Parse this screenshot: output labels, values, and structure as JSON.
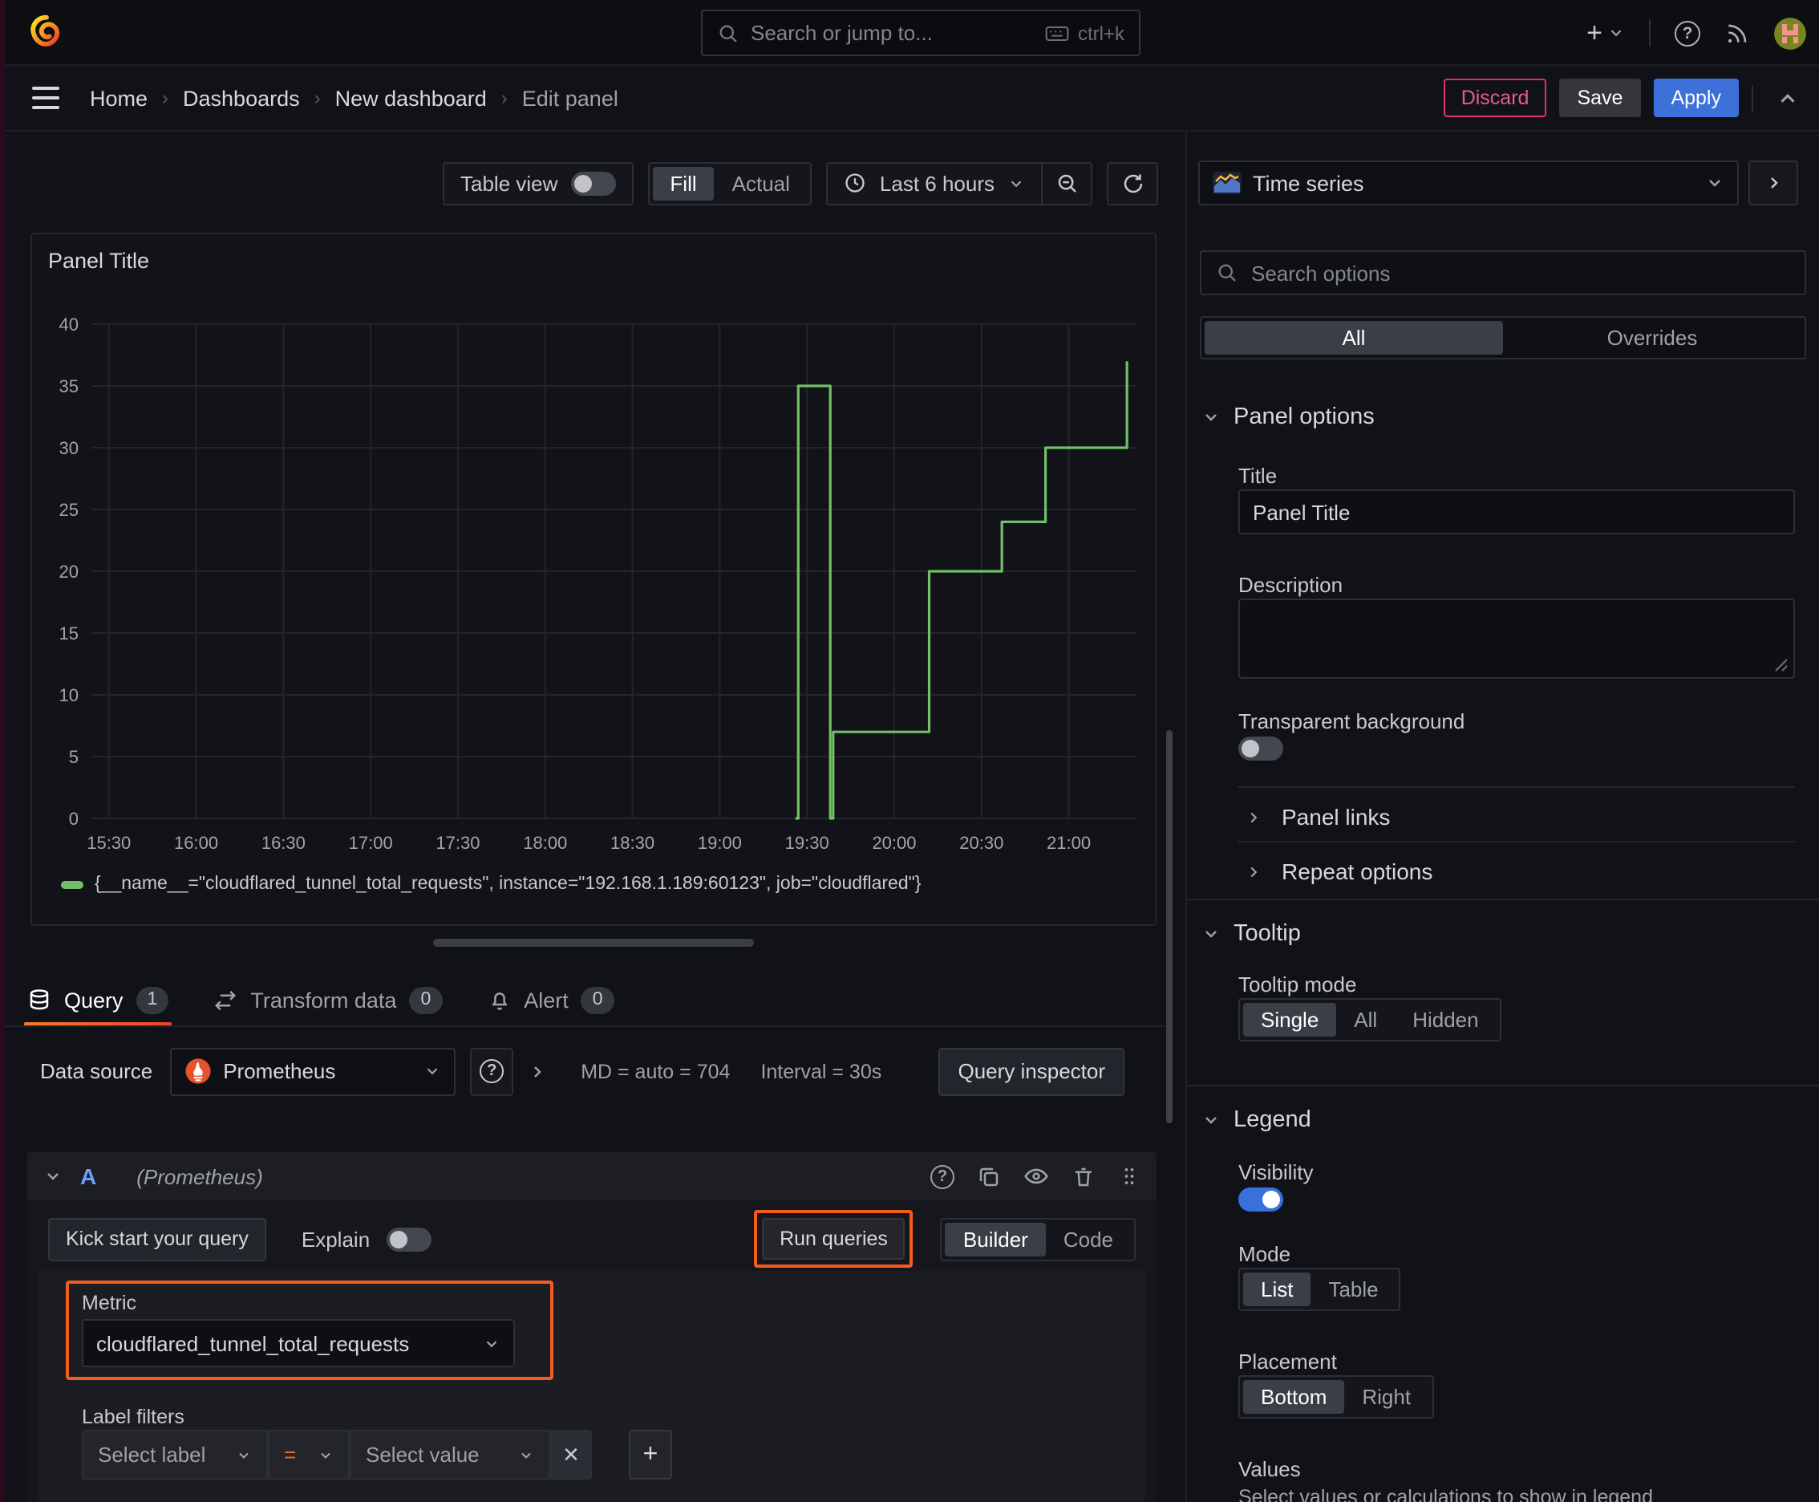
{
  "navbar": {
    "search_placeholder": "Search or jump to...",
    "search_shortcut": "ctrl+k"
  },
  "breadcrumb": {
    "items": [
      "Home",
      "Dashboards",
      "New dashboard",
      "Edit panel"
    ],
    "discard": "Discard",
    "save": "Save",
    "apply": "Apply"
  },
  "toolbar": {
    "table_view": "Table view",
    "fill": "Fill",
    "actual": "Actual",
    "time_range": "Last 6 hours"
  },
  "panel": {
    "title": "Panel Title"
  },
  "chart_data": {
    "type": "line",
    "title": "Panel Title",
    "step": true,
    "grid": true,
    "legend_position": "bottom",
    "x_ticks": [
      "15:30",
      "16:00",
      "16:30",
      "17:00",
      "17:30",
      "18:00",
      "18:30",
      "19:00",
      "19:30",
      "20:00",
      "20:30",
      "21:00"
    ],
    "y_ticks": [
      0,
      5,
      10,
      15,
      20,
      25,
      30,
      35,
      40
    ],
    "x_range": [
      "15:24",
      "21:23"
    ],
    "y_range": [
      0,
      40
    ],
    "series": [
      {
        "name": "{__name__=\"cloudflared_tunnel_total_requests\", instance=\"192.168.1.189:60123\", job=\"cloudflared\"}",
        "color": "#73bf69",
        "points": [
          [
            "19:26",
            0
          ],
          [
            "19:27",
            35
          ],
          [
            "19:38",
            0
          ],
          [
            "19:39",
            7
          ],
          [
            "20:12",
            20
          ],
          [
            "20:37",
            24
          ],
          [
            "20:52",
            30
          ],
          [
            "21:20",
            37
          ]
        ]
      }
    ]
  },
  "tabs": {
    "query": "Query",
    "query_count": "1",
    "transform": "Transform data",
    "transform_count": "0",
    "alert": "Alert",
    "alert_count": "0"
  },
  "datasource": {
    "label": "Data source",
    "name": "Prometheus",
    "md": "MD = auto = 704",
    "interval": "Interval = 30s",
    "inspector": "Query inspector"
  },
  "query_editor": {
    "ref_id": "A",
    "ds_hint": "(Prometheus)",
    "kick_start": "Kick start your query",
    "explain": "Explain",
    "run_queries": "Run queries",
    "builder": "Builder",
    "code": "Code",
    "metric_label": "Metric",
    "metric_value": "cloudflared_tunnel_total_requests",
    "label_filters": "Label filters",
    "select_label": "Select label",
    "equals": "=",
    "select_value": "Select value",
    "remove": "✕",
    "add": "+"
  },
  "options": {
    "panel_type": "Time series",
    "search_placeholder": "Search options",
    "tab_all": "All",
    "tab_overrides": "Overrides",
    "panel_options": "Panel options",
    "title_label": "Title",
    "title_value": "Panel Title",
    "description_label": "Description",
    "transparent_bg": "Transparent background",
    "panel_links": "Panel links",
    "repeat_options": "Repeat options",
    "tooltip": "Tooltip",
    "tooltip_mode": "Tooltip mode",
    "tooltip_modes": [
      "Single",
      "All",
      "Hidden"
    ],
    "legend": "Legend",
    "visibility": "Visibility",
    "mode": "Mode",
    "modes": [
      "List",
      "Table"
    ],
    "placement": "Placement",
    "placements": [
      "Bottom",
      "Right"
    ],
    "values_label": "Values",
    "values_help": "Select values or calculations to show in legend"
  },
  "colors": {
    "accent_orange": "#f25c1f",
    "apply_blue": "#3d71d9",
    "discard_pink": "#e0316e",
    "series_green": "#73bf69",
    "toggle_blue": "#3871dc"
  }
}
